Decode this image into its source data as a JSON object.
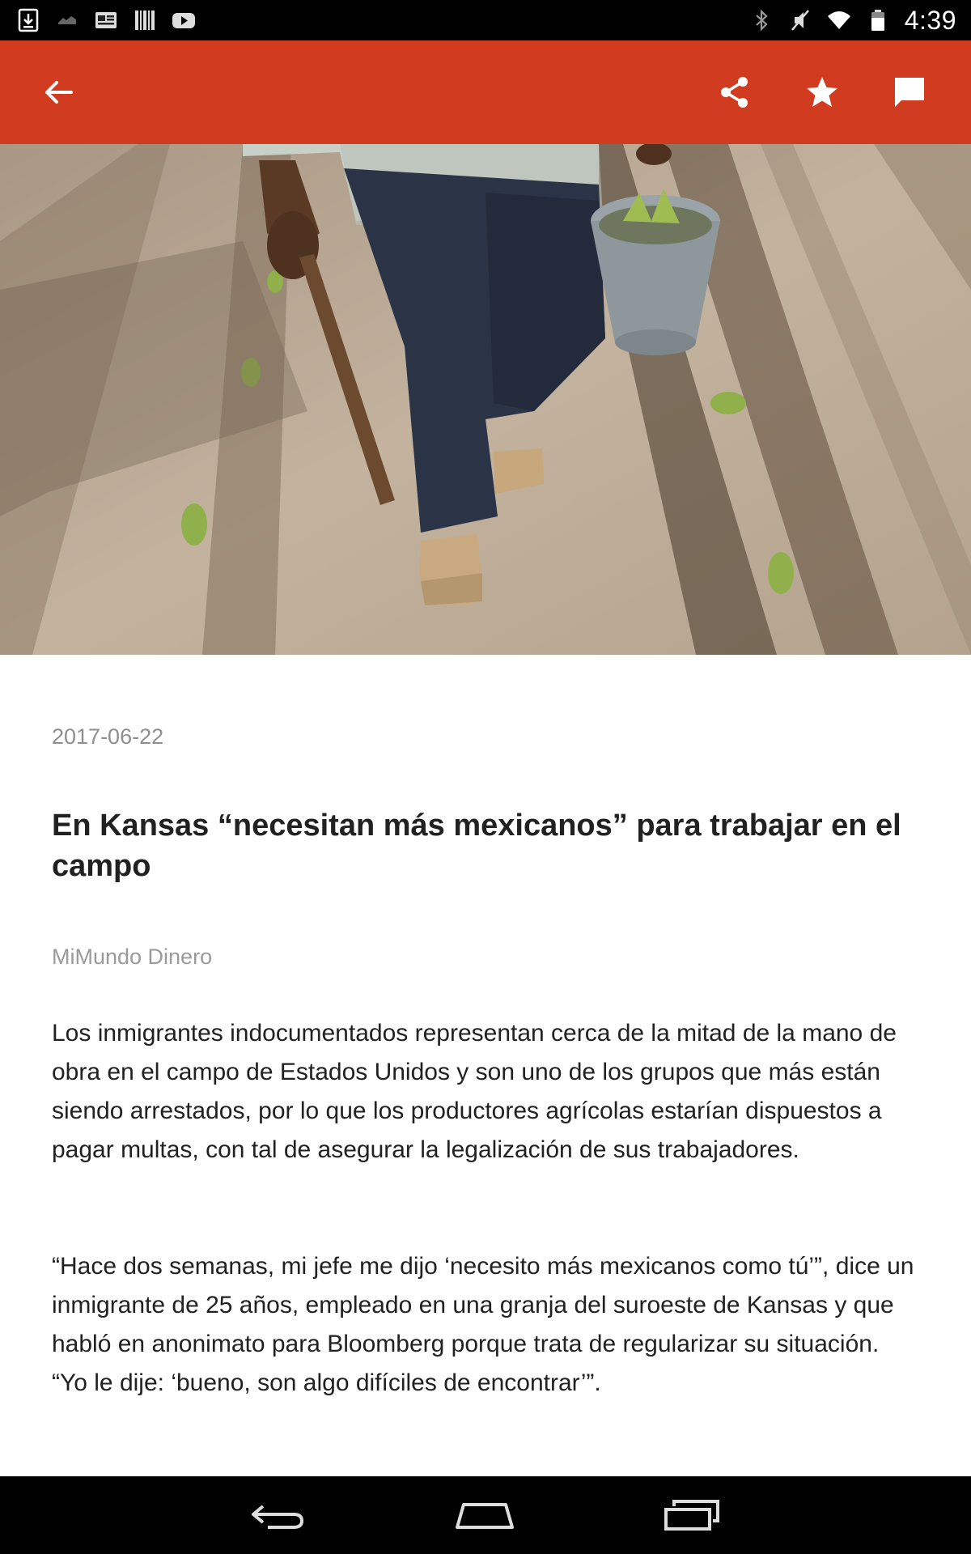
{
  "status_bar": {
    "time": "4:39",
    "left_icons": [
      "download-icon",
      "notification-icon",
      "news-icon",
      "barcode-icon",
      "youtube-icon"
    ],
    "right_icons": [
      "bluetooth-icon",
      "mute-icon",
      "wifi-icon",
      "battery-icon"
    ]
  },
  "app_bar": {
    "background": "#d13b1f",
    "icons": [
      "back-arrow-icon",
      "share-icon",
      "star-icon",
      "comment-icon"
    ]
  },
  "article": {
    "date": "2017-06-22",
    "title": "En Kansas “necesitan más mexicanos” para trabajar en el campo",
    "source": "MiMundo Dinero",
    "paragraphs": [
      "Los inmigrantes indocumentados representan cerca de la mitad de la mano de obra en el campo de Estados Unidos y son uno de los grupos que más están siendo arrestados, por lo que los productores agrícolas estarían dispuestos a pagar multas, con tal de asegurar la legalización de sus trabajadores.",
      "“Hace dos semanas, mi jefe me dijo ‘necesito más mexicanos como tú’”, dice un inmigrante de 25 años, empleado en una granja del suroeste de Kansas y que habló en anonimato para Bloomberg porque trata de regularizar su situación. “Yo le dije: ‘bueno, son algo difíciles de encontrar’”."
    ]
  },
  "nav_bar": {
    "icons": [
      "nav-back-icon",
      "nav-home-icon",
      "nav-recents-icon"
    ]
  }
}
